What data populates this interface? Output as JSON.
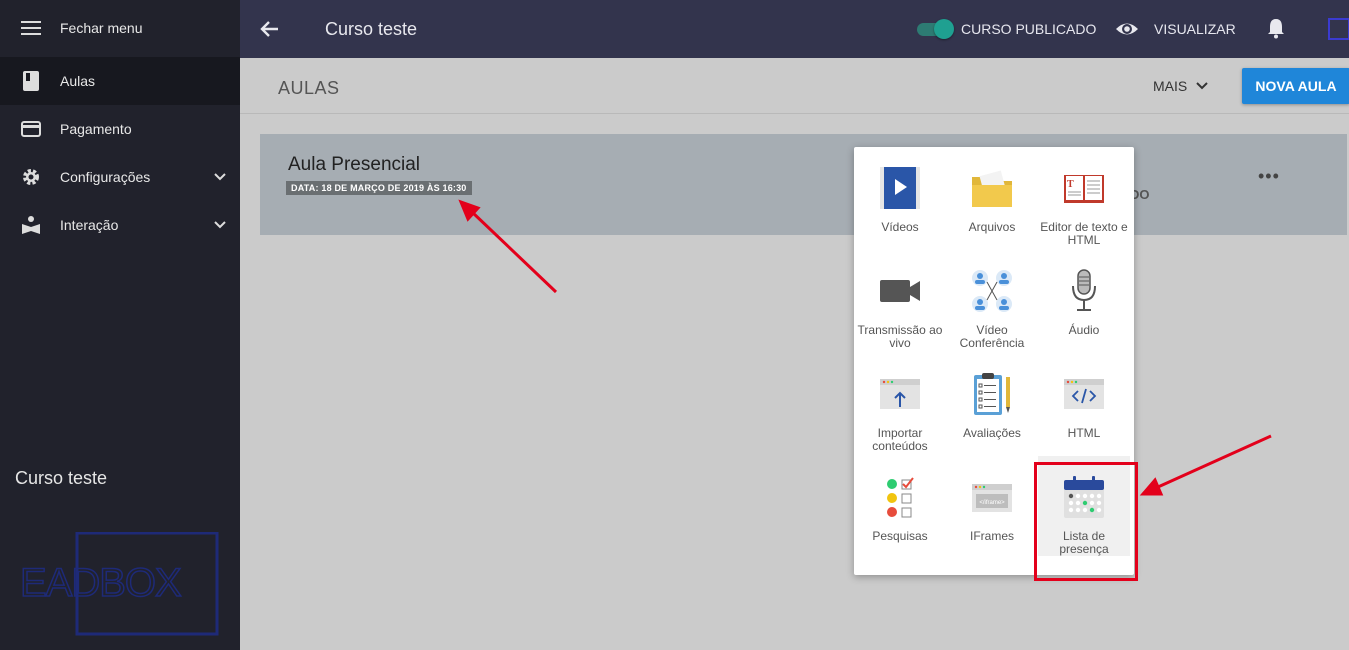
{
  "sidebar": {
    "items": [
      {
        "label": "Fechar menu",
        "icon": "hamburger-icon"
      },
      {
        "label": "Aulas",
        "icon": "book-icon"
      },
      {
        "label": "Pagamento",
        "icon": "credit-card-icon"
      },
      {
        "label": "Configurações",
        "icon": "gear-icon"
      },
      {
        "label": "Interação",
        "icon": "reader-icon"
      }
    ],
    "course_name": "Curso teste",
    "logo_text": "EADBOX"
  },
  "header": {
    "title": "Curso teste",
    "published_label": "CURSO PUBLICADO",
    "view_label": "VISUALIZAR"
  },
  "toolbar": {
    "title": "AULAS",
    "more_label": "MAIS",
    "new_lesson_label": "NOVA AULA"
  },
  "lesson": {
    "title": "Aula Presencial",
    "date": "DATA: 18 DE MARÇO DE 2019 ÀS 16:30",
    "status_fragment": "DO"
  },
  "menu": {
    "options": [
      {
        "label": "Vídeos",
        "icon": "video-icon"
      },
      {
        "label": "Arquivos",
        "icon": "folder-icon"
      },
      {
        "label": "Editor de texto e HTML",
        "icon": "text-editor-icon"
      },
      {
        "label": "Transmissão ao vivo",
        "icon": "camera-icon"
      },
      {
        "label": "Vídeo Conferência",
        "icon": "conference-icon"
      },
      {
        "label": "Áudio",
        "icon": "microphone-icon"
      },
      {
        "label": "Importar conteúdos",
        "icon": "import-icon"
      },
      {
        "label": "Avaliações",
        "icon": "clipboard-icon"
      },
      {
        "label": "HTML",
        "icon": "html-code-icon"
      },
      {
        "label": "Pesquisas",
        "icon": "survey-icon"
      },
      {
        "label": "IFrames",
        "icon": "iframe-icon"
      },
      {
        "label": "Lista de presença",
        "icon": "calendar-icon"
      }
    ]
  },
  "colors": {
    "sidebar": "#21222c",
    "header": "#33344d",
    "accent": "#1f86d9",
    "toggle": "#1fa091",
    "annotation": "#e3001b"
  }
}
